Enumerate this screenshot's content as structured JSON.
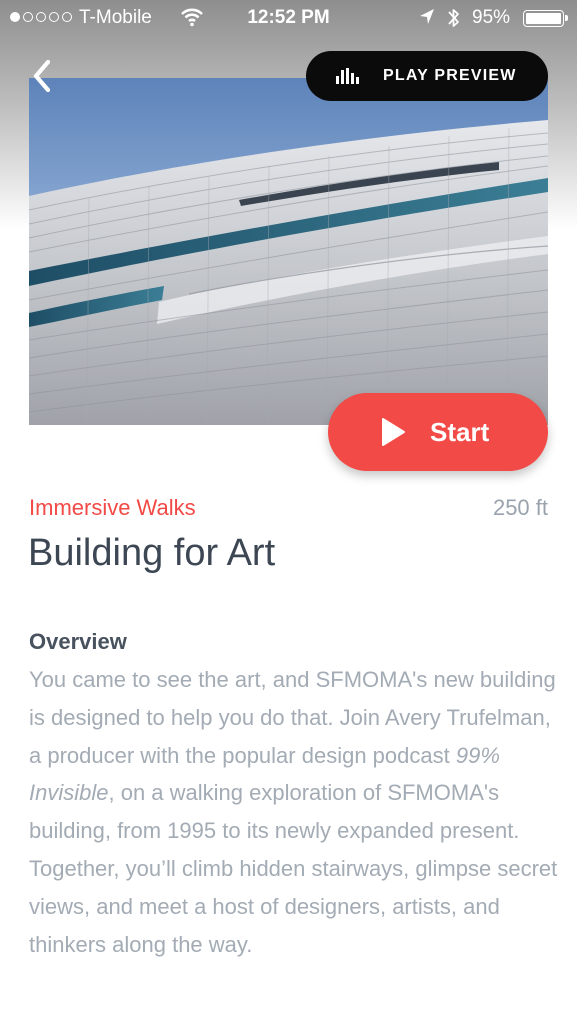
{
  "status_bar": {
    "carrier": "T-Mobile",
    "time": "12:52 PM",
    "battery_percent": "95%",
    "signal_bars_filled": 1,
    "signal_bars_total": 5
  },
  "header": {
    "back_icon": "chevron-left-icon",
    "preview_button": {
      "icon": "audio-bars-icon",
      "label": "PLAY PREVIEW"
    }
  },
  "hero": {
    "image": "sfmoma-building-facade-photo"
  },
  "start_button": {
    "icon": "play-icon",
    "label": "Start"
  },
  "tour": {
    "category": "Immersive Walks",
    "distance": "250 ft",
    "title": "Building for Art"
  },
  "overview": {
    "heading": "Overview",
    "text_before": "You came to see the art, and SFMOMA's new building is designed to help you do that. Join Avery Trufelman, a producer with the popular design podcast ",
    "text_italic": "99% Invisible",
    "text_after": ", on a walking exploration of SFMOMA's building, from 1995 to its newly expanded present. Together, you’ll climb hidden stairways, glimpse secret views, and meet a host of designers, artists, and thinkers along the way."
  },
  "colors": {
    "accent": "#f24a46",
    "title_text": "#3d4754",
    "body_text": "#a3abb4",
    "preview_button_bg": "#0b0b0c"
  }
}
